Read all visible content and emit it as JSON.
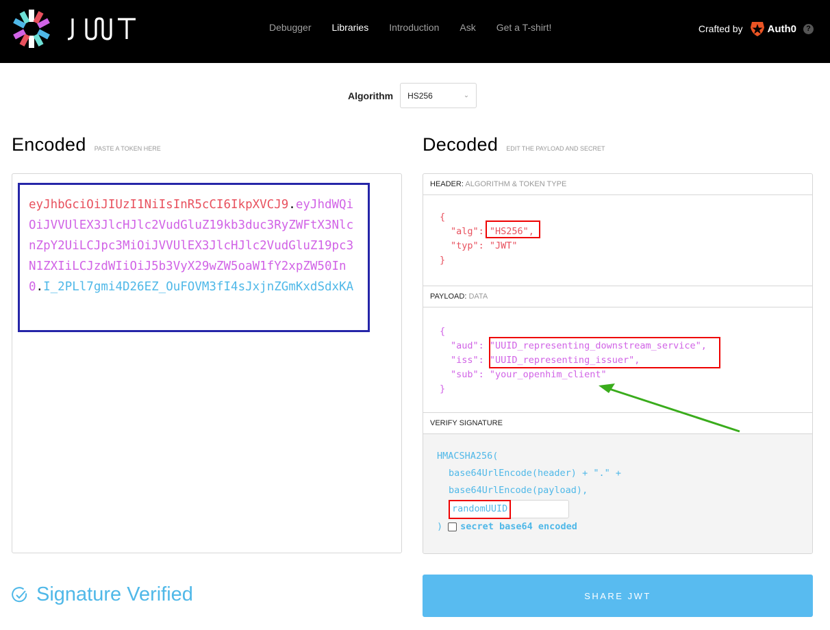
{
  "navbar": {
    "logo_text": "JWT",
    "links": [
      {
        "label": "Debugger",
        "active": false
      },
      {
        "label": "Libraries",
        "active": true
      },
      {
        "label": "Introduction",
        "active": false
      },
      {
        "label": "Ask",
        "active": false
      },
      {
        "label": "Get a T-shirt!",
        "active": false
      }
    ],
    "crafted_by": "Crafted by",
    "brand": "Auth0",
    "help": "?"
  },
  "algorithm": {
    "label": "Algorithm",
    "selected": "HS256"
  },
  "encoded": {
    "title": "Encoded",
    "subtitle": "PASTE A TOKEN HERE",
    "token_header": "eyJhbGciOiJIUzI1NiIsInR5cCI6IkpXVCJ9",
    "token_payload": "eyJhdWQiOiJVVUlEX3JlcHJlc2VudGluZ19kb3duc3RyZWFtX3NlcnZpY2UiLCJpc3MiOiJVVUlEX3JlcHJlc2VudGluZ19pc3N1ZXIiLCJzdWIiOiJ5b3VyX29wZW5oaW1fY2xpZW50In0",
    "token_signature": "I_2PLl7gmi4D26EZ_OuFOVM3fI4sJxjnZGmKxdSdxKA",
    "dot": "."
  },
  "decoded": {
    "title": "Decoded",
    "subtitle": "EDIT THE PAYLOAD AND SECRET",
    "header_label": "HEADER:",
    "header_sub": "ALGORITHM & TOKEN TYPE",
    "header_lines": [
      "{",
      "\"alg\": \"HS256\",",
      "\"typ\": \"JWT\"",
      "}"
    ],
    "payload_label": "PAYLOAD:",
    "payload_sub": "DATA",
    "payload_lines": [
      "{",
      "\"aud\": \"UUID_representing_downstream_service\",",
      "\"iss\": \"UUID_representing_issuer\",",
      "\"sub\": \"your_openhim_client\"",
      "}"
    ],
    "verify_label": "VERIFY SIGNATURE",
    "verify_lines": [
      "HMACSHA256(",
      "base64UrlEncode(header) + \".\" +",
      "base64UrlEncode(payload),"
    ],
    "secret_value": "randomUUID",
    "close_paren": ")",
    "base64_label": "secret base64 encoded",
    "base64_checked": false
  },
  "status": {
    "text": "Signature Verified",
    "color": "#4fb8e8"
  },
  "share_button": "SHARE JWT",
  "annotations": {
    "box_color": "#e00000",
    "arrow_color": "#3aac1c",
    "encoded_box_color": "#2525a8"
  }
}
